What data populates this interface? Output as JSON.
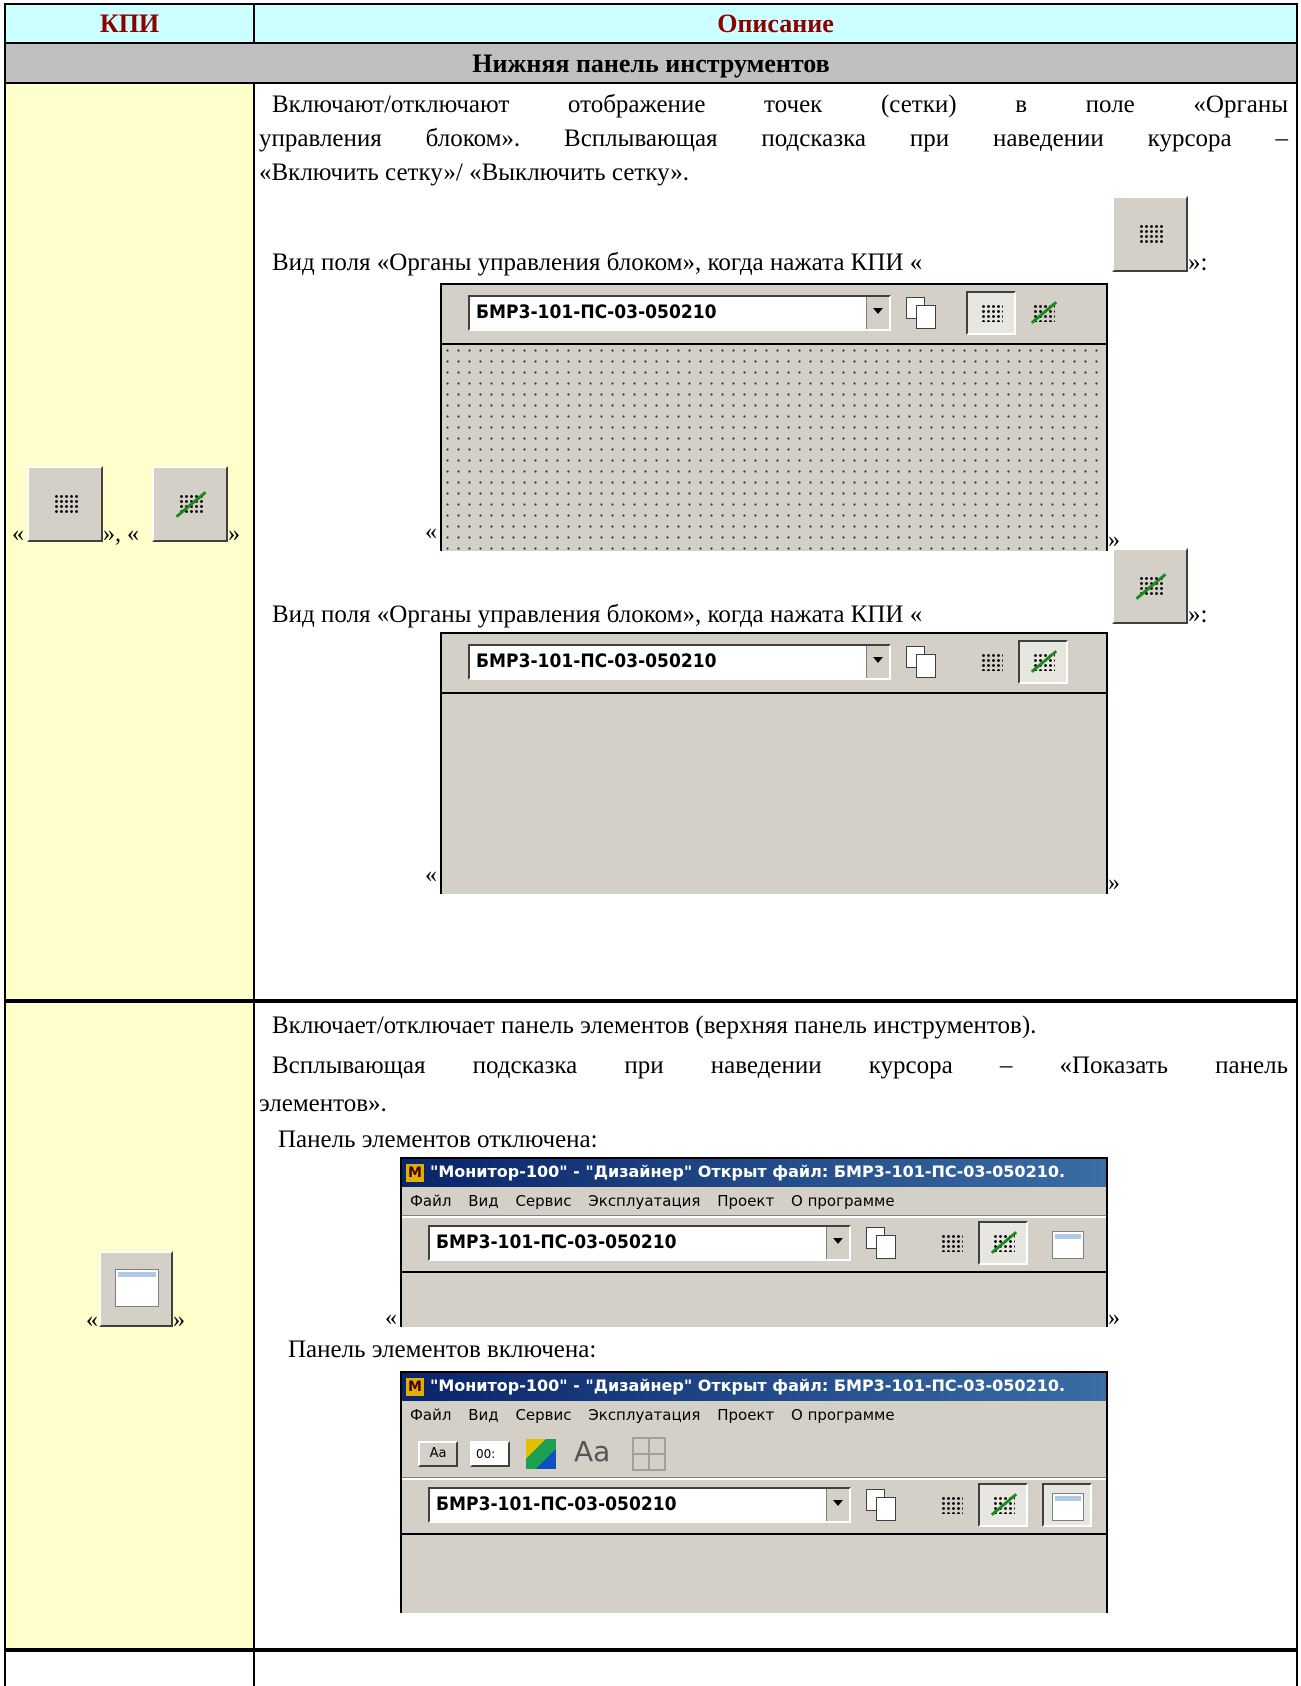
{
  "table": {
    "col_kpi": "КПИ",
    "col_desc": "Описание",
    "section_title": "Нижняя панель инструментов"
  },
  "row1": {
    "kpi_open": "«",
    "kpi_mid": "», «",
    "kpi_close": "»",
    "desc_lines": [
      "Включают/отключают отображение точек (сетки) в поле «Органы",
      "управления блоком». Всплывающая подсказка при наведении курсора –",
      "«Включить сетку»/ «Выключить сетку»."
    ],
    "view_grid_on": "Вид поля «Органы управления блоком», когда нажата КПИ «",
    "view_grid_off": "Вид поля «Органы управления блоком», когда нажата КПИ «",
    "caption_end": "»:"
  },
  "toolbar": {
    "combo_value": "БМР3-101-ПС-03-050210"
  },
  "row2": {
    "desc_line1": "Включает/отключает панель элементов (верхняя панель инструментов).",
    "desc_line2": "Всплывающая подсказка при наведении курсора – «Показать панель",
    "desc_line3": "элементов».",
    "panel_off": "Панель элементов отключена:",
    "panel_on": "Панель элементов включена:",
    "kpi_open": "«",
    "kpi_close": "»"
  },
  "app": {
    "title": "\"Монитор-100\" - \"Дизайнер\" Открыт файл: БМР3-101-ПС-03-050210.",
    "logo": "M",
    "menu": [
      "Файл",
      "Вид",
      "Сервис",
      "Эксплуатация",
      "Проект",
      "О программе"
    ],
    "elements_tools": [
      "Aa",
      "00:",
      "Aa"
    ]
  },
  "colors": {
    "header_bg": "#ccffff",
    "header_text": "#8b0000",
    "section_bg": "#c0c0c0",
    "kpi_bg": "#ffffcc"
  }
}
